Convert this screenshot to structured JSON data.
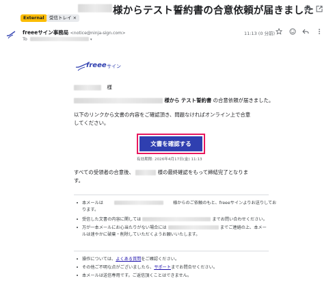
{
  "header": {
    "subject": "様からテスト誓約書の合意依頼が届きました",
    "labels": [
      "External",
      "受信トレイ ×"
    ]
  },
  "message": {
    "sender_name": "freeeサイン事務局",
    "sender_email": "<notice@ninja-sign.com>",
    "to_label": "To",
    "time": "11:13 (0 分前)"
  },
  "brand": {
    "logo_text": "freee",
    "logo_sub": "サイン",
    "accent": "#2f3fb0",
    "highlight": "#e8175d"
  },
  "body": {
    "salutation": "様",
    "sender_suffix": "様から",
    "doc_name": "テスト誓約書",
    "line1_tail": "の合意依頼が届きました。",
    "line2": "以下のリンクから文書の内容をご確認頂き、問題なければオンライン上で合意",
    "line3": "してください。",
    "cta_label": "文書を確認する",
    "deadline": "有効期限: 2026年4月17日(金) 11:13",
    "after1_a": "すべての受領者の合意後、",
    "after1_b": "様の最終確認をもって締結完了となりま",
    "after2": "す。"
  },
  "notes": {
    "n1_a": "本メールは",
    "n1_b": "様からのご依頼のもと、freeeサインよりお送りしてお",
    "n1_c": "ります。",
    "n2_a": "受信した文書の内容に関しては",
    "n2_b": "までお問い合わせください。",
    "n3_a": "万が一本メールにお心当たりがない場合には",
    "n3_b": "までご連絡の上、本メー",
    "n3_c": "ルは速やかに破棄・削除していただくようお願いいたします。",
    "f1_a": "操作については、",
    "f1_link": "よくある質問",
    "f1_b": "をご確認ください。",
    "f2_a": "その他ご不明な点がございましたら、",
    "f2_link": "サポート",
    "f2_b": "までお問合せください。",
    "f3": "本メールは送信専用です。ご返信頂くことはできません。"
  }
}
